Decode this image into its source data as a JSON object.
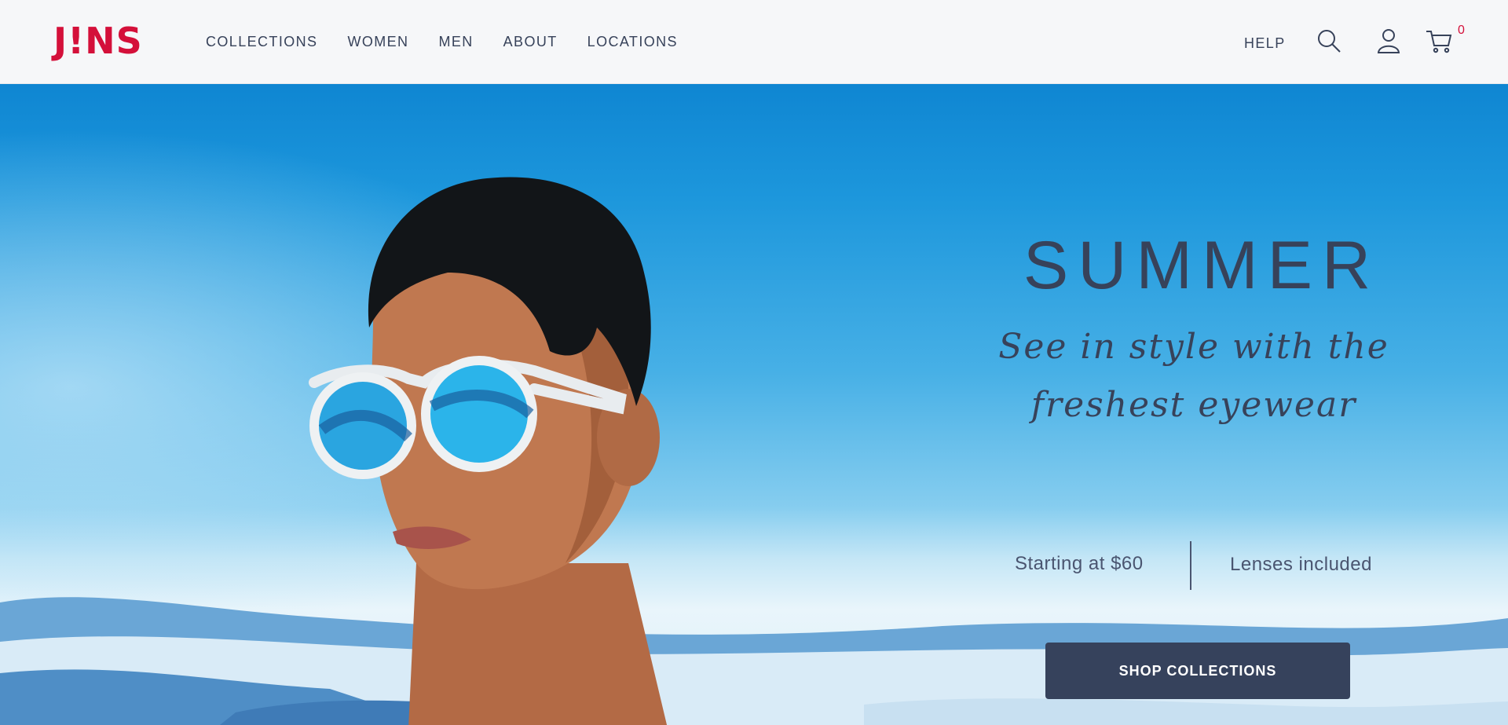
{
  "header": {
    "logo": "J!NS",
    "nav": [
      "COLLECTIONS",
      "WOMEN",
      "MEN",
      "ABOUT",
      "LOCATIONS"
    ],
    "help": "HELP",
    "cart_count": "0",
    "icons": [
      "search-icon",
      "user-icon",
      "cart-icon"
    ]
  },
  "hero": {
    "headline": "SUMMER",
    "tagline": "See in style with the freshest eyewear",
    "offer_price": "Starting at $60",
    "offer_lenses": "Lenses included",
    "cta_label": "SHOP COLLECTIONS"
  },
  "colors": {
    "brand": "#d4103a",
    "text": "#37425a",
    "button": "#36425c",
    "sky": "#1d97dc"
  }
}
